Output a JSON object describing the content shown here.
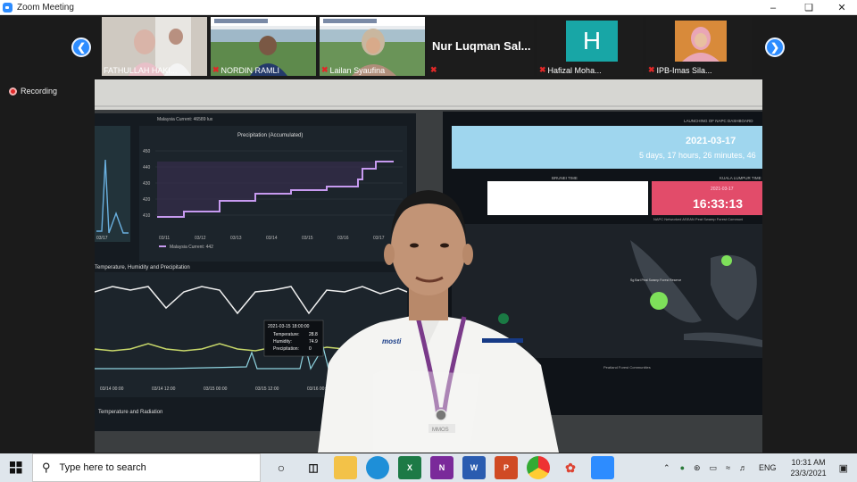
{
  "window": {
    "title": "Zoom Meeting"
  },
  "gallery": [
    {
      "name": "FATHULLAH HAKI...",
      "muted": false
    },
    {
      "name": "NORDIN RAMLI",
      "muted": true
    },
    {
      "name": "Lailan Syaufina",
      "muted": true
    },
    {
      "name": "Nur Luqman Sal...",
      "muted": true
    },
    {
      "name": "Hafizal Moha...",
      "muted": true,
      "initial": "H"
    },
    {
      "name": "IPB-Imas Sila...",
      "muted": true
    }
  ],
  "status": {
    "recording": "Recording"
  },
  "dashboard": {
    "left_top_legend": "Malaysia Current: 46589 lux",
    "chart1": {
      "title": "Precipitation (Accumulated)",
      "legend": "Malaysia Current: 442",
      "yticks": [
        "450",
        "440",
        "430",
        "420",
        "410"
      ],
      "xticks": [
        "03/11",
        "03/12",
        "03/13",
        "03/14",
        "03/15",
        "03/16",
        "03/17"
      ]
    },
    "left_xtick": "03/17",
    "chart2": {
      "title": "Temperature, Humidity and Precipitation",
      "xticks": [
        "03/14 00:00",
        "03/14 12:00",
        "03/15 00:00",
        "03/15 12:00",
        "03/16 00:00"
      ],
      "tooltip": {
        "date": "2021-03-15 18:00:00",
        "rows": [
          {
            "label": "Temperature:",
            "value": "28.8"
          },
          {
            "label": "Humidity:",
            "value": "74.9"
          },
          {
            "label": "Precipitation:",
            "value": "0"
          }
        ]
      }
    },
    "chart3_title": "Temperature and Radiation",
    "right": {
      "header": "LAUNCHING OF NAPC DASHBOARD",
      "date": "2021-03-17",
      "elapsed": "5 days, 17 hours, 26 minutes, 46",
      "brunei_label": "BRUNEI TIME",
      "kl_label": "KUALA LUMPUR TIME",
      "kl_date": "2021-03-17",
      "kl_time": "16:33:13",
      "map_title": "NAPC Networked ASEAN Peat Swamp Forest Communi",
      "map_label": "Sg Bari Peat Swamp Forest Reserve",
      "map_footer": "Peatland Forest Communities"
    },
    "shirt_logo": "mosti",
    "badge_text": "MMOS"
  },
  "taskbar": {
    "search_placeholder": "Type here to search",
    "apps": [
      {
        "name": "task-view",
        "label": ""
      },
      {
        "name": "file-explorer",
        "label": ""
      },
      {
        "name": "edge",
        "label": ""
      },
      {
        "name": "excel",
        "label": "X"
      },
      {
        "name": "onenote",
        "label": "N"
      },
      {
        "name": "word",
        "label": "W"
      },
      {
        "name": "powerpoint",
        "label": "P"
      },
      {
        "name": "chrome",
        "label": ""
      },
      {
        "name": "paint",
        "label": ""
      },
      {
        "name": "zoom",
        "label": ""
      }
    ],
    "lang": "ENG",
    "time": "10:31 AM",
    "date": "23/3/2021"
  }
}
